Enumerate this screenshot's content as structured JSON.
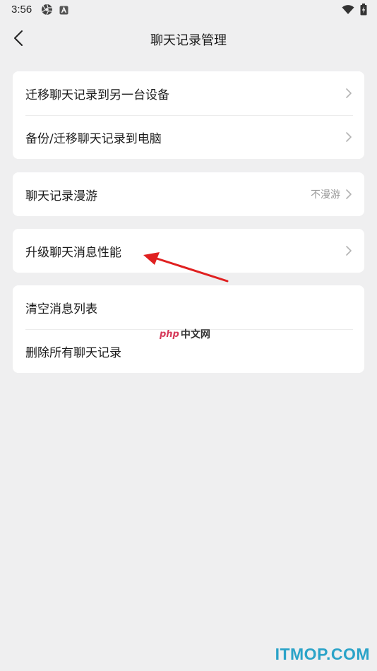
{
  "status": {
    "time": "3:56"
  },
  "nav": {
    "title": "聊天记录管理"
  },
  "groups": [
    {
      "items": [
        {
          "label": "迁移聊天记录到另一台设备"
        },
        {
          "label": "备份/迁移聊天记录到电脑"
        }
      ]
    },
    {
      "items": [
        {
          "label": "聊天记录漫游",
          "value": "不漫游"
        }
      ]
    },
    {
      "items": [
        {
          "label": "升级聊天消息性能"
        }
      ]
    },
    {
      "items": [
        {
          "label": "清空消息列表"
        },
        {
          "label": "删除所有聊天记录"
        }
      ]
    }
  ],
  "watermarks": {
    "php_logo": "php",
    "php_text": "中文网",
    "site": "ITMOP.COM"
  },
  "colors": {
    "background": "#efeff0",
    "card": "#ffffff",
    "annotation_arrow": "#e02020",
    "itmop": "#2aa3c8"
  }
}
